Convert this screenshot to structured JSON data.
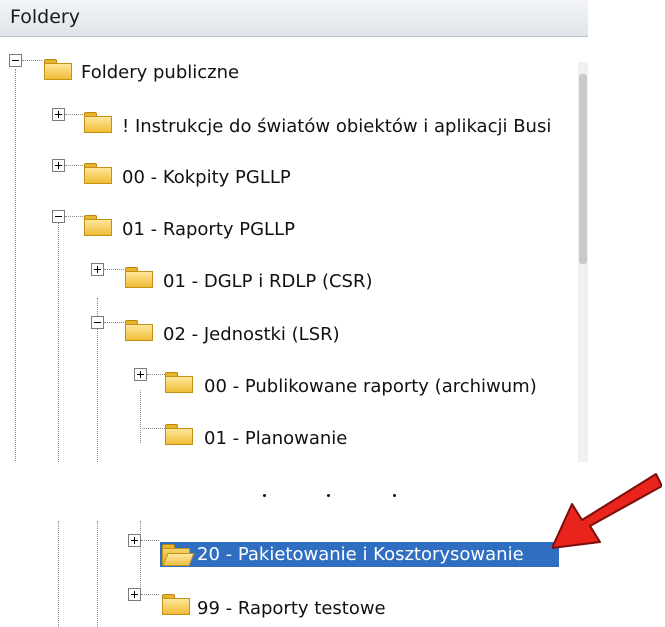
{
  "panel": {
    "title": "Foldery"
  },
  "tree": {
    "root": {
      "label": "Foldery publiczne"
    },
    "item_instrukcje": {
      "label": "! Instrukcje do światów obiektów i aplikacji Busi"
    },
    "item_kokpity": {
      "label": "00 - Kokpity PGLLP"
    },
    "item_raporty": {
      "label": "01 - Raporty PGLLP"
    },
    "item_dglp": {
      "label": "01 - DGLP i RDLP (CSR)"
    },
    "item_jednostki": {
      "label": "02 - Jednostki (LSR)"
    },
    "item_publikowane": {
      "label": "00 - Publikowane raporty (archiwum)"
    },
    "item_planowanie": {
      "label": "01 - Planowanie"
    },
    "item_pakietowanie": {
      "label": "20 - Pakietowanie i Kosztorysowanie"
    },
    "item_testowe": {
      "label": "99 - Raporty testowe"
    }
  },
  "colors": {
    "selection": "#2f6ec0",
    "arrow": "#e8241c",
    "folder": "#f0bd37"
  }
}
